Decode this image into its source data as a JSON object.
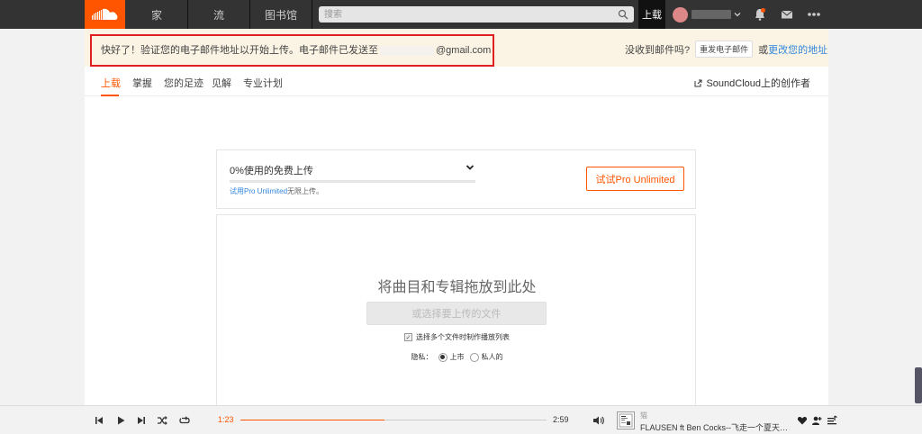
{
  "header": {
    "nav": [
      "家",
      "流",
      "图书馆"
    ],
    "search_placeholder": "搜索",
    "upload_label": "上载"
  },
  "banner": {
    "text_before": "快好了！验证您的电子邮件地址以开始上传。电子邮件已发送至",
    "email_suffix": "@gmail.com",
    "question": "没收到邮件吗?",
    "resend_label": "重发电子邮件",
    "or": "或",
    "change_link": "更改您的地址"
  },
  "subtabs": {
    "items": [
      "上载",
      "掌握",
      "您的足迹",
      "见解",
      "专业计划"
    ],
    "creators_label": "SoundCloud上的创作者"
  },
  "quota": {
    "title": "0%使用的免费上传",
    "used_fraction": 0.0,
    "sub_link": "试用Pro Unlimited",
    "sub_rest": "无限上传。",
    "pro_button": "试试Pro Unlimited"
  },
  "dropzone": {
    "title": "将曲目和专辑拖放到此处",
    "choose_button": "或选择要上传的文件",
    "playlist_option": "选择多个文件时制作播放列表",
    "privacy_label": "隐私：",
    "public_label": "上市",
    "private_label": "私人的",
    "selected_privacy": "public"
  },
  "player": {
    "current_time": "1:23",
    "total_time": "2:59",
    "progress_fraction": 0.47,
    "artist": "猫",
    "track": "FLAUSEN ft Ben Cocks--飞走一个夏天（Ac..."
  },
  "colors": {
    "brand": "#ff5500",
    "header_bg": "#333333",
    "banner_bg": "#fbf3e4",
    "highlight_box": "#e02020",
    "link": "#3388dd"
  }
}
